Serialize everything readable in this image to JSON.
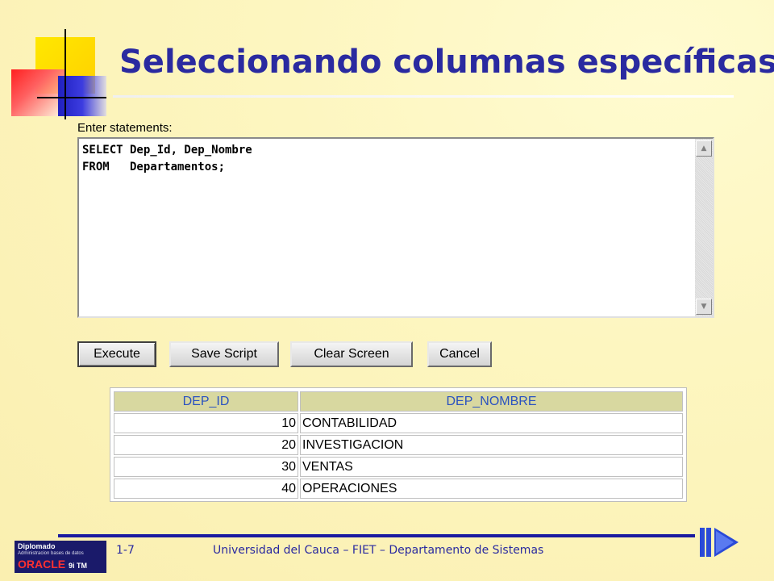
{
  "slide": {
    "title": "Seleccionando columnas específicas"
  },
  "editor": {
    "label": "Enter statements:",
    "statement": "SELECT Dep_Id, Dep_Nombre\nFROM   Departamentos;"
  },
  "buttons": {
    "execute": "Execute",
    "save_script": "Save Script",
    "clear_screen": "Clear Screen",
    "cancel": "Cancel"
  },
  "results": {
    "columns": [
      "DEP_ID",
      "DEP_NOMBRE"
    ],
    "rows": [
      [
        "10",
        "CONTABILIDAD"
      ],
      [
        "20",
        "INVESTIGACION"
      ],
      [
        "30",
        "VENTAS"
      ],
      [
        "40",
        "OPERACIONES"
      ]
    ]
  },
  "footer": {
    "page": "1-7",
    "text": "Universidad del Cauca – FIET – Departamento de Sistemas",
    "logo": {
      "line1": "Diplomado",
      "line2": "Administracion bases de datos",
      "line3": "ORACLE",
      "line3_suffix": "9i TM"
    }
  },
  "colors": {
    "title": "#2a2aa0",
    "header_bg": "#d8d8a0",
    "header_text": "#2a52c0",
    "footer_rule": "#1a1aa0"
  },
  "icons": {
    "nav": "next-slide-icon",
    "scroll_up": "scroll-up-icon",
    "scroll_down": "scroll-down-icon"
  }
}
